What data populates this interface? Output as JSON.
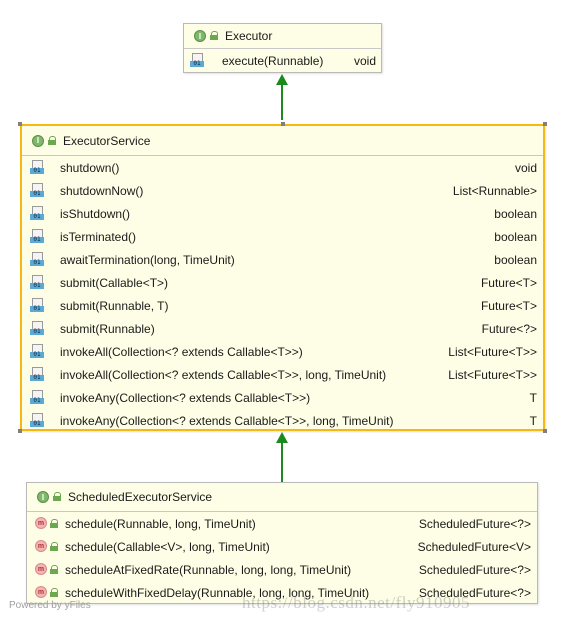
{
  "executor": {
    "name": "Executor",
    "stereotype": "I",
    "methods": [
      {
        "signature": "execute(Runnable)",
        "returns": "void"
      }
    ]
  },
  "executor_service": {
    "name": "ExecutorService",
    "stereotype": "I",
    "methods": [
      {
        "signature": "shutdown()",
        "returns": "void"
      },
      {
        "signature": "shutdownNow()",
        "returns": "List<Runnable>"
      },
      {
        "signature": "isShutdown()",
        "returns": "boolean"
      },
      {
        "signature": "isTerminated()",
        "returns": "boolean"
      },
      {
        "signature": "awaitTermination(long, TimeUnit)",
        "returns": "boolean"
      },
      {
        "signature": "submit(Callable<T>)",
        "returns": "Future<T>"
      },
      {
        "signature": "submit(Runnable, T)",
        "returns": "Future<T>"
      },
      {
        "signature": "submit(Runnable)",
        "returns": "Future<?>"
      },
      {
        "signature": "invokeAll(Collection<? extends Callable<T>>)",
        "returns": "List<Future<T>>"
      },
      {
        "signature": "invokeAll(Collection<? extends Callable<T>>, long, TimeUnit)",
        "returns": "List<Future<T>>"
      },
      {
        "signature": "invokeAny(Collection<? extends Callable<T>>)",
        "returns": "T"
      },
      {
        "signature": "invokeAny(Collection<? extends Callable<T>>, long, TimeUnit)",
        "returns": "T"
      }
    ]
  },
  "scheduled_executor_service": {
    "name": "ScheduledExecutorService",
    "stereotype": "I",
    "methods": [
      {
        "signature": "schedule(Runnable, long, TimeUnit)",
        "returns": "ScheduledFuture<?>"
      },
      {
        "signature": "schedule(Callable<V>, long, TimeUnit)",
        "returns": "ScheduledFuture<V>"
      },
      {
        "signature": "scheduleAtFixedRate(Runnable, long, long, TimeUnit)",
        "returns": "ScheduledFuture<?>"
      },
      {
        "signature": "scheduleWithFixedDelay(Runnable, long, long, TimeUnit)",
        "returns": "ScheduledFuture<?>"
      }
    ]
  },
  "icons": {
    "abstract_method_label": "01",
    "method_label": "m"
  },
  "colors": {
    "selection": "#f5b814",
    "node_fill": "#fefee6",
    "edge": "#1a8a1a"
  },
  "footer": {
    "text": "Powered by yFiles"
  },
  "watermark": {
    "text": "https://blog.csdn.net/fly910905"
  }
}
